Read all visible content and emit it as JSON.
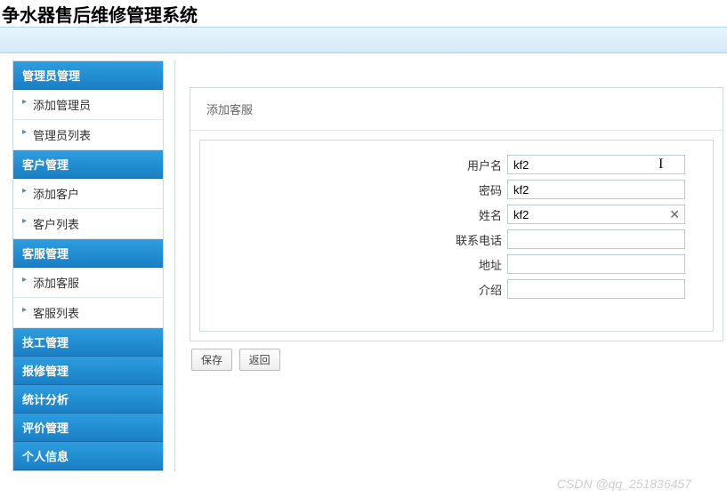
{
  "header": {
    "title": "争水器售后维修管理系统"
  },
  "sidebar": {
    "groups": [
      {
        "title": "管理员管理",
        "items": [
          {
            "label": "添加管理员"
          },
          {
            "label": "管理员列表"
          }
        ]
      },
      {
        "title": "客户管理",
        "items": [
          {
            "label": "添加客户"
          },
          {
            "label": "客户列表"
          }
        ]
      },
      {
        "title": "客服管理",
        "items": [
          {
            "label": "添加客服"
          },
          {
            "label": "客服列表"
          }
        ]
      },
      {
        "title": "技工管理",
        "items": []
      },
      {
        "title": "报修管理",
        "items": []
      },
      {
        "title": "统计分析",
        "items": []
      },
      {
        "title": "评价管理",
        "items": []
      },
      {
        "title": "个人信息",
        "items": []
      }
    ]
  },
  "panel": {
    "title": "添加客服"
  },
  "form": {
    "fields": {
      "username": {
        "label": "用户名",
        "value": "kf2"
      },
      "password": {
        "label": "密码",
        "value": "kf2"
      },
      "name": {
        "label": "姓名",
        "value": "kf2"
      },
      "phone": {
        "label": "联系电话",
        "value": ""
      },
      "address": {
        "label": "地址",
        "value": ""
      },
      "intro": {
        "label": "介绍",
        "value": ""
      }
    },
    "buttons": {
      "save": "保存",
      "back": "返回"
    }
  },
  "watermark": "CSDN @qq_251836457"
}
